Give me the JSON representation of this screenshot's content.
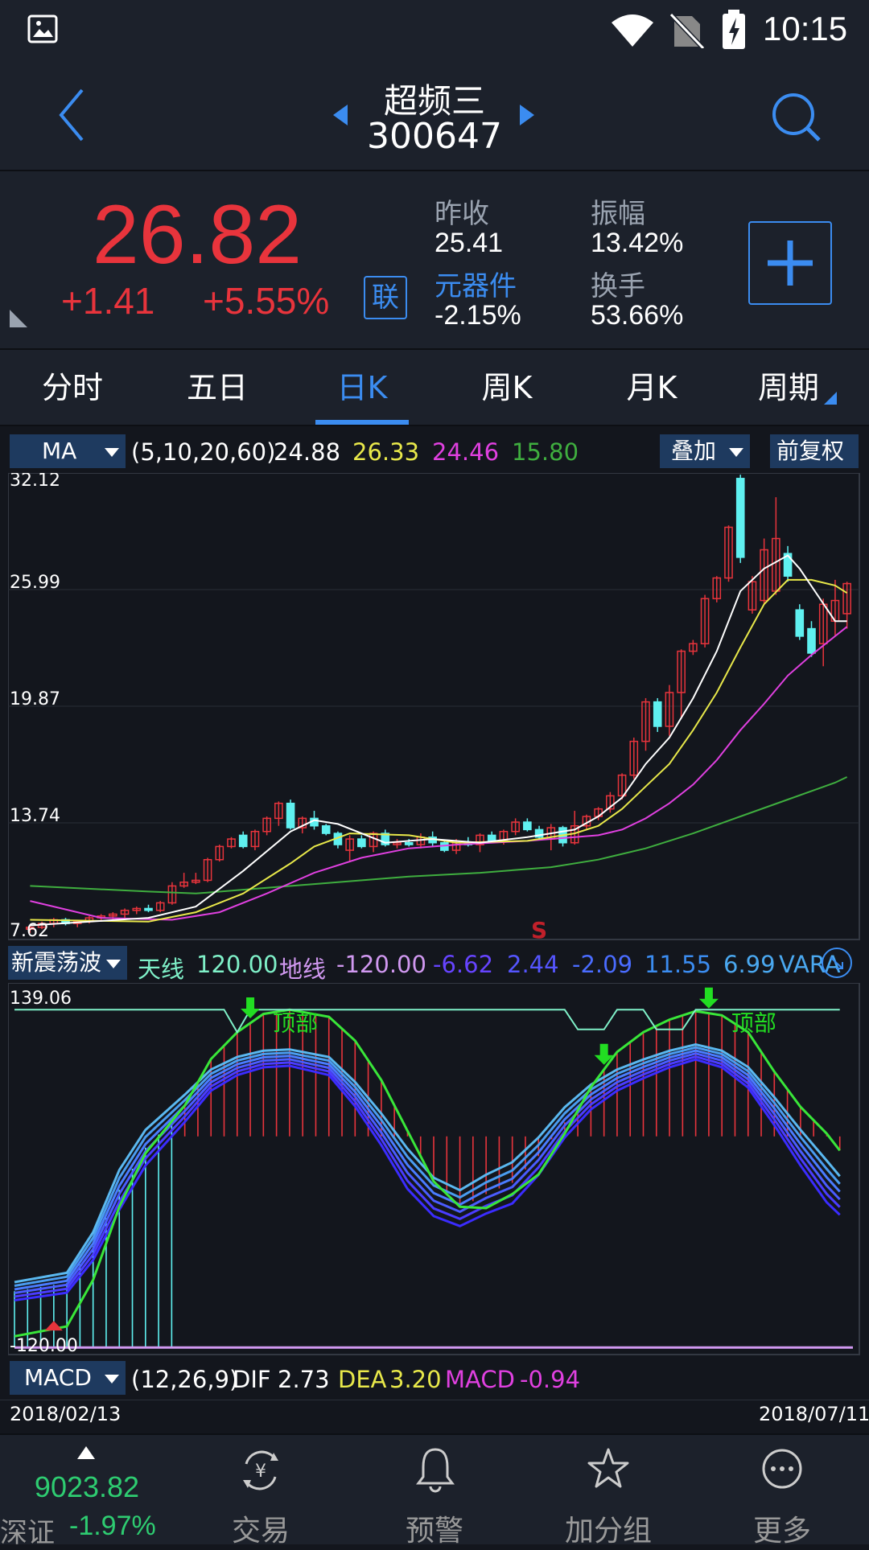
{
  "status": {
    "time": "10:15"
  },
  "header": {
    "stock_name": "超频三",
    "stock_code": "300647"
  },
  "quote": {
    "price": "26.82",
    "change": "+1.41",
    "change_pct": "+5.55%",
    "link_badge": "联",
    "prev_close_label": "昨收",
    "prev_close": "25.41",
    "sector_label": "元器件",
    "sector_change": "-2.15%",
    "amplitude_label": "振幅",
    "amplitude": "13.42%",
    "turnover_label": "换手",
    "turnover": "53.66%",
    "colors": {
      "up": "#e8343c",
      "down": "#2ecc71",
      "accent": "#3b8cf0"
    }
  },
  "tabs": [
    "分时",
    "五日",
    "日K",
    "周K",
    "月K",
    "周期"
  ],
  "active_tab": "日K",
  "ma_bar": {
    "selector": "MA",
    "params": "(5,10,20,60)",
    "values": [
      "24.88",
      "26.33",
      "24.46",
      "15.80"
    ],
    "overlay_button": "叠加",
    "adjust_button": "前复权"
  },
  "main_chart_labels": {
    "y_ticks": [
      "32.12",
      "25.99",
      "19.87",
      "13.74",
      "7.62"
    ],
    "signal": "S"
  },
  "indicator_bar": {
    "selector": "新震荡波",
    "sky_label": "天线",
    "sky_value": "120.00",
    "ground_label": "地线",
    "ground_value": "-120.00",
    "values": [
      "-6.62",
      "2.44",
      "-2.09",
      "11.55",
      "6.99"
    ],
    "suffix": "VARA"
  },
  "indicator_chart_labels": {
    "top": "139.06",
    "bottom": "-120.00",
    "annotation": "顶部"
  },
  "macd_bar": {
    "selector": "MACD",
    "params": "(12,26,9)",
    "dif_label": "DIF",
    "dif": "2.73",
    "dea_label": "DEA",
    "dea": "3.20",
    "macd_label": "MACD",
    "macd": "-0.94"
  },
  "dates": {
    "start": "2018/02/13",
    "end": "2018/07/11"
  },
  "bottom_nav": {
    "index_value": "9023.82",
    "index_name": "深证",
    "index_change": "-1.97%",
    "items": [
      "交易",
      "预警",
      "加分组",
      "更多"
    ]
  },
  "chart_data": {
    "type": "candlestick",
    "x_start": "2018/02/13",
    "x_end": "2018/07/11",
    "ylim": [
      7.62,
      32.12
    ],
    "y_ticks": [
      32.12,
      25.99,
      19.87,
      13.74,
      7.62
    ],
    "ma_legend": {
      "MA5": 24.88,
      "MA10": 26.33,
      "MA20": 24.46,
      "MA60": 15.8
    },
    "ma_colors": {
      "MA5": "#ffffff",
      "MA10": "#e8e84a",
      "MA20": "#e040e0",
      "MA60": "#3fae3f"
    },
    "candles": [
      [
        8.0,
        8.2,
        7.8,
        8.1
      ],
      [
        8.1,
        8.4,
        8.0,
        8.3
      ],
      [
        8.3,
        8.6,
        8.1,
        8.5
      ],
      [
        8.5,
        8.6,
        8.2,
        8.3
      ],
      [
        8.3,
        8.5,
        8.1,
        8.4
      ],
      [
        8.4,
        8.7,
        8.3,
        8.6
      ],
      [
        8.6,
        8.8,
        8.4,
        8.7
      ],
      [
        8.7,
        8.9,
        8.5,
        8.8
      ],
      [
        8.8,
        9.1,
        8.6,
        9.0
      ],
      [
        9.0,
        9.2,
        8.8,
        9.1
      ],
      [
        9.1,
        9.3,
        8.9,
        9.0
      ],
      [
        9.0,
        9.5,
        8.9,
        9.4
      ],
      [
        9.4,
        10.5,
        9.3,
        10.3
      ],
      [
        10.3,
        11.0,
        10.2,
        10.5
      ],
      [
        10.5,
        11.0,
        10.4,
        10.6
      ],
      [
        10.6,
        11.8,
        10.5,
        11.7
      ],
      [
        11.7,
        12.5,
        11.6,
        12.4
      ],
      [
        12.4,
        12.9,
        12.3,
        12.8
      ],
      [
        13.0,
        13.2,
        12.3,
        12.4
      ],
      [
        12.4,
        13.3,
        12.2,
        13.2
      ],
      [
        13.2,
        14.0,
        13.0,
        13.9
      ],
      [
        13.9,
        14.8,
        13.5,
        14.7
      ],
      [
        14.7,
        14.9,
        13.3,
        13.4
      ],
      [
        13.4,
        14.0,
        13.1,
        13.9
      ],
      [
        13.9,
        14.3,
        13.3,
        13.5
      ],
      [
        13.5,
        13.6,
        13.0,
        13.1
      ],
      [
        13.1,
        13.2,
        12.3,
        12.5
      ],
      [
        12.2,
        13.0,
        11.6,
        12.8
      ],
      [
        12.8,
        13.0,
        12.3,
        12.4
      ],
      [
        12.4,
        13.2,
        12.1,
        13.1
      ],
      [
        13.1,
        13.3,
        12.4,
        12.5
      ],
      [
        12.5,
        12.8,
        12.3,
        12.6
      ],
      [
        12.6,
        12.8,
        12.4,
        12.5
      ],
      [
        12.5,
        13.1,
        12.3,
        12.9
      ],
      [
        12.9,
        13.2,
        12.4,
        12.6
      ],
      [
        12.6,
        12.7,
        12.1,
        12.2
      ],
      [
        12.2,
        12.8,
        12.0,
        12.6
      ],
      [
        12.6,
        12.9,
        12.4,
        12.5
      ],
      [
        12.5,
        13.1,
        12.1,
        13.0
      ],
      [
        13.0,
        13.2,
        12.6,
        12.7
      ],
      [
        12.7,
        13.3,
        12.5,
        13.2
      ],
      [
        13.2,
        13.9,
        13.0,
        13.7
      ],
      [
        13.7,
        13.9,
        13.2,
        13.3
      ],
      [
        13.3,
        13.5,
        12.8,
        12.9
      ],
      [
        12.8,
        13.6,
        12.2,
        13.4
      ],
      [
        13.4,
        13.5,
        12.4,
        12.6
      ],
      [
        12.6,
        14.3,
        12.5,
        13.5
      ],
      [
        13.5,
        14.1,
        13.3,
        14.0
      ],
      [
        14.0,
        14.5,
        13.8,
        14.4
      ],
      [
        14.4,
        15.3,
        14.2,
        15.1
      ],
      [
        15.1,
        16.3,
        14.9,
        16.2
      ],
      [
        16.2,
        18.2,
        16.0,
        18.0
      ],
      [
        18.0,
        20.3,
        17.5,
        20.1
      ],
      [
        20.1,
        20.3,
        18.5,
        18.8
      ],
      [
        18.8,
        21.0,
        18.3,
        20.6
      ],
      [
        20.6,
        22.9,
        19.2,
        22.8
      ],
      [
        22.8,
        23.4,
        22.6,
        23.2
      ],
      [
        23.2,
        25.8,
        23.0,
        25.6
      ],
      [
        25.6,
        26.8,
        25.4,
        26.7
      ],
      [
        26.7,
        29.5,
        26.5,
        29.4
      ],
      [
        32.0,
        32.2,
        27.5,
        27.8
      ],
      [
        25.0,
        26.8,
        24.8,
        26.5
      ],
      [
        25.5,
        28.8,
        25.3,
        28.2
      ],
      [
        26.0,
        31.0,
        25.8,
        28.8
      ],
      [
        28.0,
        28.4,
        26.5,
        26.8
      ],
      [
        25.0,
        25.3,
        23.4,
        23.6
      ],
      [
        24.0,
        24.4,
        22.5,
        22.7
      ],
      [
        23.2,
        25.6,
        22.0,
        25.3
      ],
      [
        24.4,
        26.6,
        23.6,
        25.5
      ],
      [
        24.8,
        26.5,
        24.0,
        26.4
      ]
    ],
    "ma_lines": {
      "MA5": [
        [
          0,
          8.2
        ],
        [
          10,
          8.6
        ],
        [
          14,
          9.2
        ],
        [
          18,
          11.1
        ],
        [
          22,
          13.2
        ],
        [
          24,
          13.8
        ],
        [
          26,
          13.6
        ],
        [
          30,
          12.6
        ],
        [
          34,
          12.8
        ],
        [
          38,
          12.6
        ],
        [
          42,
          12.9
        ],
        [
          46,
          13.3
        ],
        [
          48,
          14.0
        ],
        [
          50,
          15.0
        ],
        [
          52,
          16.8
        ],
        [
          54,
          18.2
        ],
        [
          56,
          20.3
        ],
        [
          58,
          22.8
        ],
        [
          60,
          26.0
        ],
        [
          62,
          27.2
        ],
        [
          64,
          27.9
        ],
        [
          65,
          27.2
        ],
        [
          68,
          24.4
        ],
        [
          69,
          24.4
        ]
      ],
      "MA10": [
        [
          0,
          8.5
        ],
        [
          10,
          8.4
        ],
        [
          14,
          8.9
        ],
        [
          18,
          9.9
        ],
        [
          22,
          11.5
        ],
        [
          24,
          12.4
        ],
        [
          27,
          13.1
        ],
        [
          32,
          13.0
        ],
        [
          36,
          12.6
        ],
        [
          42,
          12.7
        ],
        [
          46,
          13.1
        ],
        [
          48,
          13.5
        ],
        [
          50,
          14.4
        ],
        [
          52,
          15.6
        ],
        [
          54,
          16.8
        ],
        [
          56,
          18.6
        ],
        [
          58,
          20.6
        ],
        [
          60,
          23.0
        ],
        [
          62,
          25.3
        ],
        [
          64,
          26.6
        ],
        [
          66,
          26.6
        ],
        [
          68,
          26.3
        ],
        [
          69,
          25.9
        ]
      ],
      "MA20": [
        [
          0,
          9.5
        ],
        [
          6,
          8.6
        ],
        [
          12,
          8.5
        ],
        [
          16,
          8.9
        ],
        [
          20,
          9.9
        ],
        [
          24,
          11.0
        ],
        [
          28,
          11.8
        ],
        [
          32,
          12.3
        ],
        [
          36,
          12.5
        ],
        [
          42,
          12.7
        ],
        [
          46,
          12.9
        ],
        [
          48,
          13.0
        ],
        [
          50,
          13.3
        ],
        [
          52,
          13.9
        ],
        [
          54,
          14.7
        ],
        [
          56,
          15.7
        ],
        [
          58,
          17.0
        ],
        [
          60,
          18.6
        ],
        [
          62,
          20.0
        ],
        [
          64,
          21.5
        ],
        [
          66,
          22.6
        ],
        [
          68,
          23.6
        ],
        [
          69,
          24.1
        ]
      ],
      "MA60": [
        [
          0,
          10.3
        ],
        [
          10,
          10.0
        ],
        [
          14,
          9.9
        ],
        [
          20,
          10.2
        ],
        [
          26,
          10.5
        ],
        [
          32,
          10.8
        ],
        [
          38,
          11.0
        ],
        [
          44,
          11.3
        ],
        [
          48,
          11.7
        ],
        [
          52,
          12.3
        ],
        [
          56,
          13.1
        ],
        [
          60,
          14.0
        ],
        [
          64,
          14.9
        ],
        [
          68,
          15.8
        ],
        [
          69,
          16.1
        ]
      ]
    },
    "oscillator": {
      "ylim": [
        -120,
        139.06
      ],
      "sky": 120,
      "ground": -120,
      "green_line": [
        [
          0,
          -112
        ],
        [
          4,
          -105
        ],
        [
          6,
          -72
        ],
        [
          8,
          -20
        ],
        [
          10,
          18
        ],
        [
          13,
          52
        ],
        [
          15,
          85
        ],
        [
          17,
          104
        ],
        [
          19,
          117
        ],
        [
          21,
          120
        ],
        [
          24,
          115
        ],
        [
          26,
          98
        ],
        [
          28,
          70
        ],
        [
          30,
          34
        ],
        [
          32,
          -2
        ],
        [
          34,
          -20
        ],
        [
          36,
          -21
        ],
        [
          38,
          -11
        ],
        [
          40,
          3
        ],
        [
          42,
          32
        ],
        [
          44,
          65
        ],
        [
          46,
          90
        ],
        [
          48,
          104
        ],
        [
          50,
          113
        ],
        [
          52,
          119
        ],
        [
          54,
          116
        ],
        [
          56,
          104
        ],
        [
          58,
          76
        ],
        [
          60,
          51
        ],
        [
          62,
          32
        ],
        [
          63,
          20
        ]
      ],
      "blue_line": [
        [
          0,
          -80
        ],
        [
          4,
          -74
        ],
        [
          6,
          -48
        ],
        [
          8,
          -8
        ],
        [
          10,
          22
        ],
        [
          13,
          50
        ],
        [
          15,
          70
        ],
        [
          17,
          80
        ],
        [
          19,
          85
        ],
        [
          21,
          86
        ],
        [
          24,
          80
        ],
        [
          26,
          60
        ],
        [
          28,
          35
        ],
        [
          30,
          7
        ],
        [
          32,
          -13
        ],
        [
          34,
          -21
        ],
        [
          36,
          -11
        ],
        [
          38,
          -3
        ],
        [
          40,
          16
        ],
        [
          42,
          40
        ],
        [
          44,
          58
        ],
        [
          46,
          70
        ],
        [
          48,
          78
        ],
        [
          50,
          85
        ],
        [
          52,
          90
        ],
        [
          54,
          85
        ],
        [
          56,
          72
        ],
        [
          58,
          48
        ],
        [
          60,
          22
        ],
        [
          62,
          -2
        ],
        [
          63,
          -12
        ]
      ],
      "sky_line": [
        [
          0,
          120
        ],
        [
          16,
          120
        ],
        [
          17,
          104
        ],
        [
          18,
          120
        ],
        [
          42,
          120
        ],
        [
          43,
          106
        ],
        [
          45,
          106
        ],
        [
          46,
          120
        ],
        [
          48,
          120
        ],
        [
          49,
          106
        ],
        [
          51,
          106
        ],
        [
          52,
          120
        ],
        [
          63,
          120
        ]
      ],
      "top_signals": [
        18,
        45,
        53
      ],
      "bottom_signal": 3
    }
  }
}
